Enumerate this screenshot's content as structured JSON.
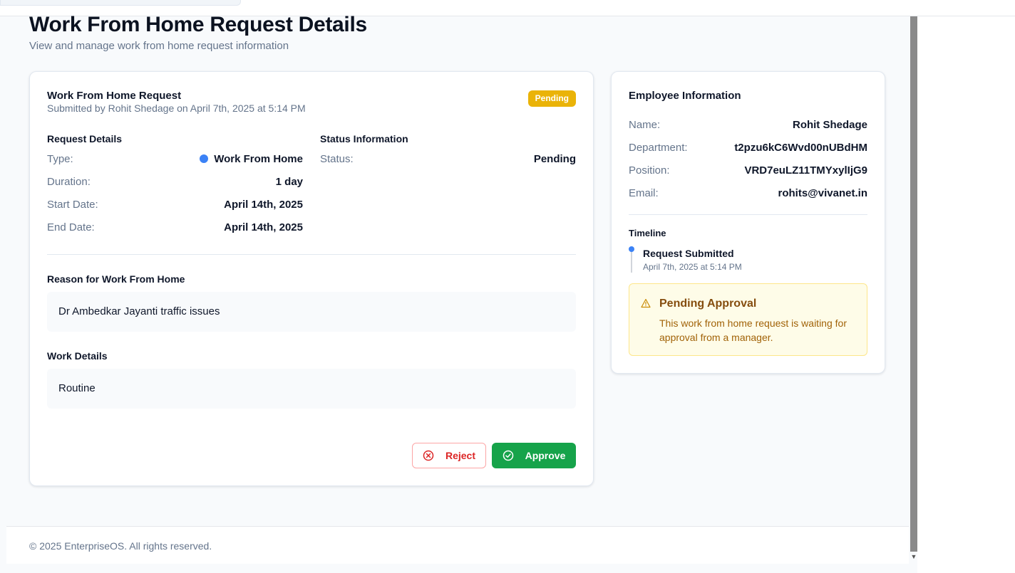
{
  "page": {
    "title": "Work From Home Request Details",
    "subtitle": "View and manage work from home request information"
  },
  "request": {
    "title": "Work From Home Request",
    "submitted": "Submitted by Rohit Shedage on April 7th, 2025 at 5:14 PM",
    "badge": "Pending",
    "details_heading": "Request Details",
    "details": [
      {
        "label": "Type:",
        "value": "Work From Home"
      },
      {
        "label": "Duration:",
        "value": "1 day"
      },
      {
        "label": "Start Date:",
        "value": "April 14th, 2025"
      },
      {
        "label": "End Date:",
        "value": "April 14th, 2025"
      }
    ],
    "status_heading": "Status Information",
    "status": {
      "label": "Status:",
      "value": "Pending"
    },
    "reason_heading": "Reason for Work From Home",
    "reason": "Dr Ambedkar Jayanti traffic issues",
    "work_heading": "Work Details",
    "work": "Routine",
    "reject_label": "Reject",
    "approve_label": "Approve"
  },
  "employee": {
    "title": "Employee Information",
    "fields": [
      {
        "label": "Name:",
        "value": "Rohit Shedage"
      },
      {
        "label": "Department:",
        "value": "t2pzu6kC6Wvd00nUBdHM"
      },
      {
        "label": "Position:",
        "value": "VRD7euLZ11TMYxylIjG9"
      },
      {
        "label": "Email:",
        "value": "rohits@vivanet.in"
      }
    ],
    "timeline_heading": "Timeline",
    "timeline": [
      {
        "event": "Request Submitted",
        "time": "April 7th, 2025 at 5:14 PM"
      }
    ],
    "alert": {
      "title": "Pending Approval",
      "text": "This work from home request is waiting for approval from a manager."
    }
  },
  "footer": {
    "text": "© 2025 EnterpriseOS. All rights reserved."
  },
  "colors": {
    "accent_blue": "#3b82f6",
    "pending_badge": "#eab308",
    "approve_green": "#16a34a",
    "reject_red": "#dc2626",
    "alert_bg": "#fefce8"
  }
}
